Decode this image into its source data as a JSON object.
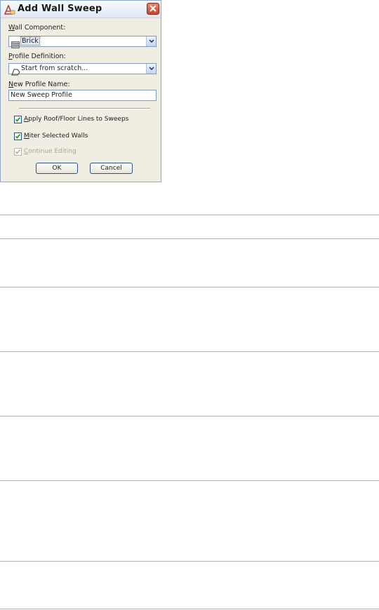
{
  "dialog": {
    "title": "Add Wall Sweep",
    "wall_component": {
      "label_accel": "W",
      "label_rest": "all Component:",
      "value": "Brick"
    },
    "profile_definition": {
      "label_accel": "P",
      "label_rest": "rofile Definition:",
      "value": "Start from scratch..."
    },
    "new_profile_name": {
      "label_accel": "N",
      "label_rest": "ew Profile Name:",
      "value": "New Sweep Profile"
    },
    "checkboxes": [
      {
        "accel": "A",
        "rest": "pply Roof/Floor Lines to Sweeps",
        "checked": true,
        "enabled": true
      },
      {
        "accel": "M",
        "rest": "iter Selected Walls",
        "checked": true,
        "enabled": true
      },
      {
        "accel": "C",
        "rest": "ontinue Editing",
        "checked": true,
        "enabled": false
      }
    ],
    "ok_label": "OK",
    "cancel_label": "Cancel"
  },
  "colors": {
    "titlebar_bg": "#e7eef8",
    "dialog_bg": "#f0ede3",
    "close_button": "#c74630",
    "check_color": "#21a121"
  }
}
